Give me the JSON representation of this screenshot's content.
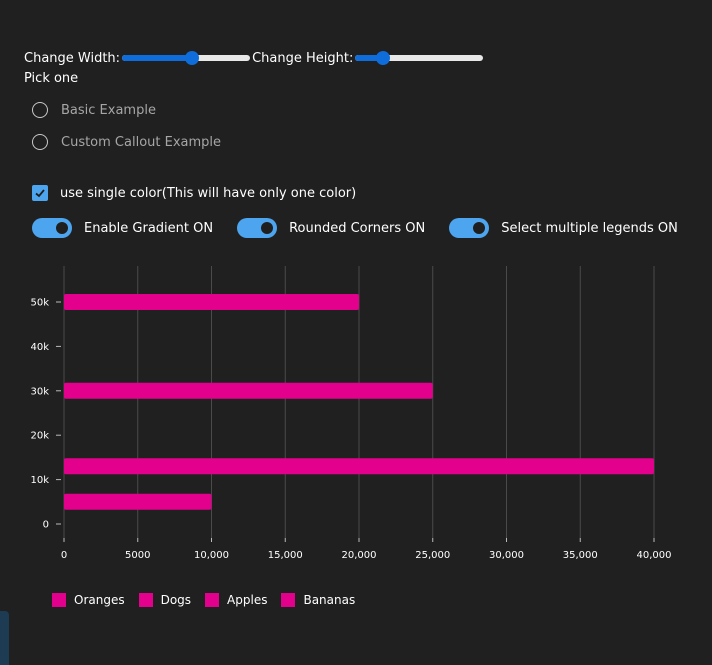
{
  "controls": {
    "width_label": "Change Width:",
    "width_value": 0.55,
    "height_label": "Change Height:",
    "height_value": 0.22
  },
  "picker": {
    "label": "Pick one",
    "options": [
      "Basic Example",
      "Custom Callout Example"
    ]
  },
  "checkbox": {
    "label": "use single color(This will have only one color)",
    "checked": true
  },
  "toggles": [
    {
      "label": "Enable Gradient ON",
      "on": true
    },
    {
      "label": "Rounded Corners ON",
      "on": true
    },
    {
      "label": "Select multiple legends ON",
      "on": true
    }
  ],
  "colors": {
    "bar": "#e3008c",
    "accent": "#0f6cdb",
    "toggle": "#4ea5ef"
  },
  "chart_data": {
    "type": "bar",
    "orientation": "horizontal",
    "x_ticks": [
      "0",
      "5000",
      "10,000",
      "15,000",
      "20,000",
      "25,000",
      "30,000",
      "35,000",
      "40,000"
    ],
    "y_ticks": [
      "0",
      "10k",
      "20k",
      "30k",
      "40k",
      "50k"
    ],
    "xlim": [
      0,
      40000
    ],
    "ylim": [
      0,
      50000
    ],
    "bars": [
      {
        "y": 50000,
        "value": 20000
      },
      {
        "y": 30000,
        "value": 25000
      },
      {
        "y": 13000,
        "value": 40000
      },
      {
        "y": 5000,
        "value": 10000
      }
    ],
    "legend": [
      "Oranges",
      "Dogs",
      "Apples",
      "Bananas"
    ],
    "grid": "vertical"
  }
}
